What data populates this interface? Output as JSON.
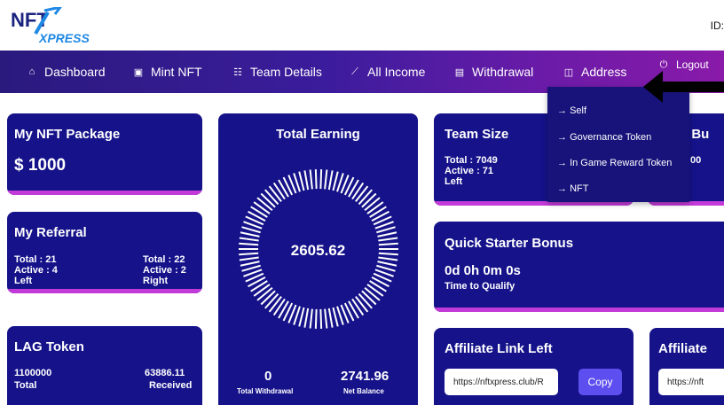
{
  "header": {
    "logo_text_top": "NFT",
    "logo_text_bottom": "XPRESS",
    "id_label": "ID:"
  },
  "nav": {
    "items": [
      {
        "label": "Dashboard",
        "icon": "home-icon"
      },
      {
        "label": "Mint NFT",
        "icon": "mint-icon"
      },
      {
        "label": "Team Details",
        "icon": "team-icon"
      },
      {
        "label": "All Income",
        "icon": "chart-icon"
      },
      {
        "label": "Withdrawal",
        "icon": "wallet-icon"
      },
      {
        "label": "Address",
        "icon": "address-icon"
      },
      {
        "label": "Logout",
        "icon": "logout-icon"
      }
    ]
  },
  "address_menu": {
    "items": [
      "Self",
      "Governance Token",
      "In Game Reward Token",
      "NFT"
    ]
  },
  "nft_package": {
    "title": "My NFT Package",
    "value": "$ 1000"
  },
  "referral": {
    "title": "My Referral",
    "left": {
      "total": "Total : 21",
      "active": "Active : 4",
      "side": "Left"
    },
    "right": {
      "total": "Total : 22",
      "active": "Active : 2",
      "side": "Right"
    }
  },
  "lag_token": {
    "title": "LAG Token",
    "total_value": "1100000",
    "total_label": "Total",
    "received_value": "63886.11",
    "received_label": "Received"
  },
  "total_earning": {
    "title": "Total Earning",
    "value": "2605.62",
    "withdrawal_value": "0",
    "withdrawal_label": "Total Withdrawal",
    "balance_value": "2741.96",
    "balance_label": "Net Balance"
  },
  "team_size": {
    "title": "Team Size",
    "total": "Total : 7049",
    "active": "Active : 71",
    "side": "Left"
  },
  "partial_card": {
    "title_fragment": "n Bu",
    "value_fragment": "00"
  },
  "quick_starter": {
    "title": "Quick Starter Bonus",
    "countdown": "0d 0h 0m 0s",
    "caption": "Time to Qualify"
  },
  "affiliate_left": {
    "title": "Affiliate Link Left",
    "link": "https://nftxpress.club/R",
    "copy_label": "Copy"
  },
  "affiliate_right": {
    "title_fragment": "Affiliate",
    "link_fragment": "https://nft"
  },
  "colors": {
    "card": "#15128a",
    "accent_stripe": "#c23ad7",
    "nav_start": "#2a1a7e",
    "nav_end": "#8a1aa9"
  }
}
